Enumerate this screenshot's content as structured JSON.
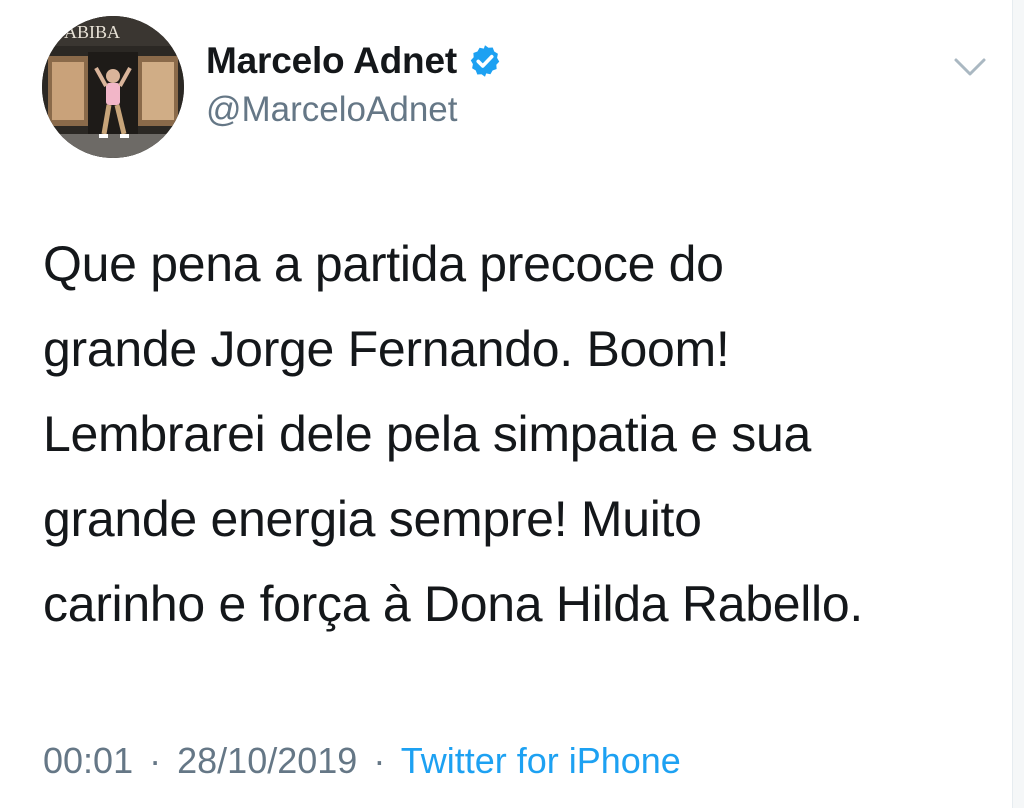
{
  "author": {
    "display_name": "Marcelo Adnet",
    "handle": "@MarceloAdnet",
    "avatar_sign_text": "ABIBA",
    "verified_icon": "verified-badge-icon"
  },
  "tweet": {
    "text": "Que pena a partida precoce do\ngrande Jorge Fernando. Boom!\nLembrarei dele pela simpatia e sua\ngrande energia sempre! Muito\ncarinho e força à Dona Hilda Rabello.",
    "time": "00:01",
    "date": "28/10/2019",
    "separator": "·",
    "source": "Twitter for iPhone"
  },
  "menu": {
    "icon": "chevron-down-icon"
  },
  "colors": {
    "text": "#14171a",
    "secondary": "#657786",
    "accent": "#1da1f2"
  }
}
